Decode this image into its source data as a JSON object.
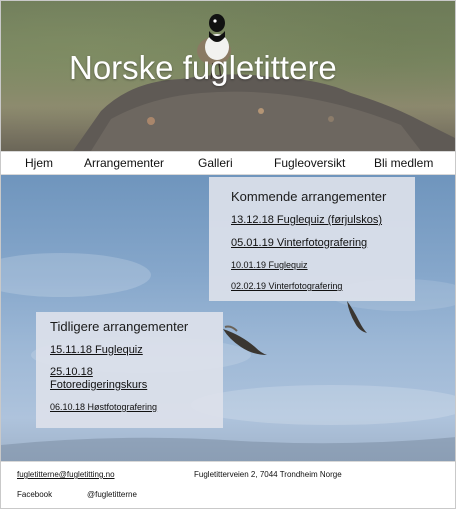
{
  "site": {
    "title": "Norske fugletittere"
  },
  "nav": {
    "items": [
      "Hjem",
      "Arrangementer",
      "Galleri",
      "Fugleoversikt",
      "Bli medlem"
    ]
  },
  "upcoming": {
    "heading": "Kommende arrangementer",
    "events": [
      "13.12.18 Fuglequiz (førjulskos)",
      "05.01.19 Vinterfotografering",
      "10.01.19 Fuglequiz",
      "02.02.19 Vinterfotografering"
    ]
  },
  "past": {
    "heading": "Tidligere arrangementer",
    "events": [
      "15.11.18 Fuglequiz",
      "25.10.18",
      "Fotoredigeringskurs",
      "06.10.18 Høstfotografering"
    ]
  },
  "footer": {
    "email": "fugletitterne@fugletitting.no",
    "address": "Fugletitterveien 2, 7044 Trondheim Norge",
    "social_label": "Facebook",
    "social_handle": "@fugletitterne"
  }
}
